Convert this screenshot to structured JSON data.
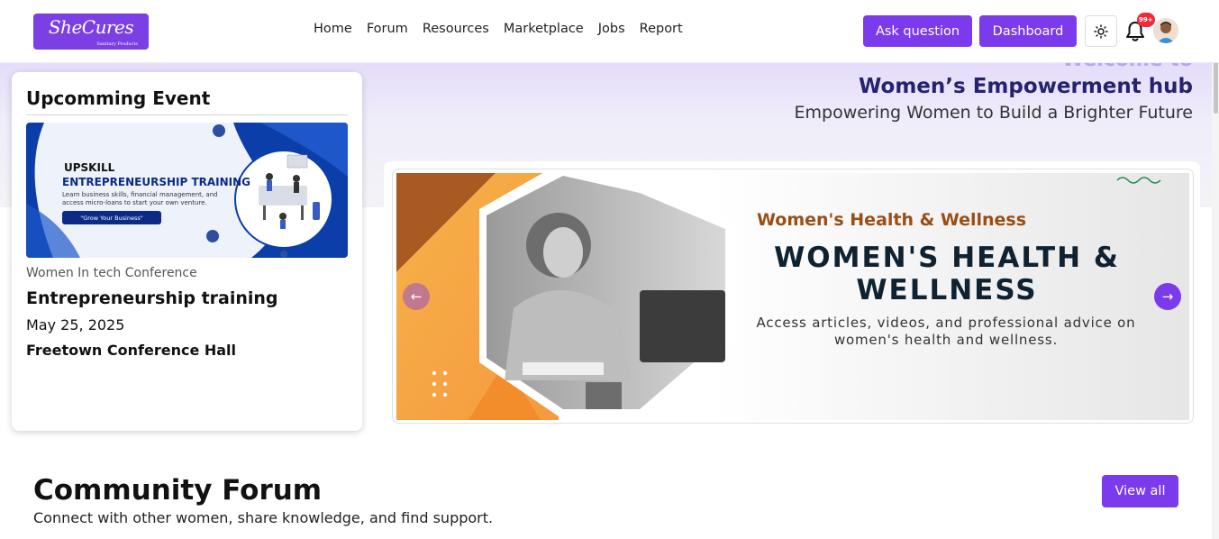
{
  "brand": {
    "name": "SheCures",
    "tagline": "Sanitary Products"
  },
  "nav": {
    "items": [
      "Home",
      "Forum",
      "Resources",
      "Marketplace",
      "Jobs",
      "Report"
    ]
  },
  "header": {
    "ask_label": "Ask question",
    "dashboard_label": "Dashboard",
    "notification_count": "99+"
  },
  "colors": {
    "accent": "#7c3aed",
    "hub_title": "#25236e",
    "kicker": "#9b4d14",
    "badge": "#ef2b3a"
  },
  "icons": [
    "sun-icon",
    "bell-icon",
    "arrow-left-icon",
    "arrow-right-icon"
  ],
  "event": {
    "section_title": "Upcomming Event",
    "banner": {
      "heading": "UPSKILL",
      "subheading": "ENTREPRENEURSHIP TRAINING",
      "body": "Learn business skills, financial management, and access micro-loans to start your own venture.",
      "pill": "\"Grow Your Business\""
    },
    "category": "Women In tech Conference",
    "name": "Entrepreneurship training",
    "date": "May 25, 2025",
    "venue": "Freetown Conference Hall"
  },
  "hero": {
    "welcome": "Welcome to",
    "title": "Women’s Empowerment hub",
    "subtitle": "Empowering Women to Build a Brighter Future"
  },
  "carousel": {
    "kicker": "Women's Health & Wellness",
    "heading": "WOMEN'S HEALTH & WELLNESS",
    "description": "Access articles, videos, and professional advice on women's health and wellness."
  },
  "forum": {
    "title": "Community Forum",
    "subtitle": "Connect with other women, share knowledge, and find support.",
    "view_all_label": "View all"
  }
}
